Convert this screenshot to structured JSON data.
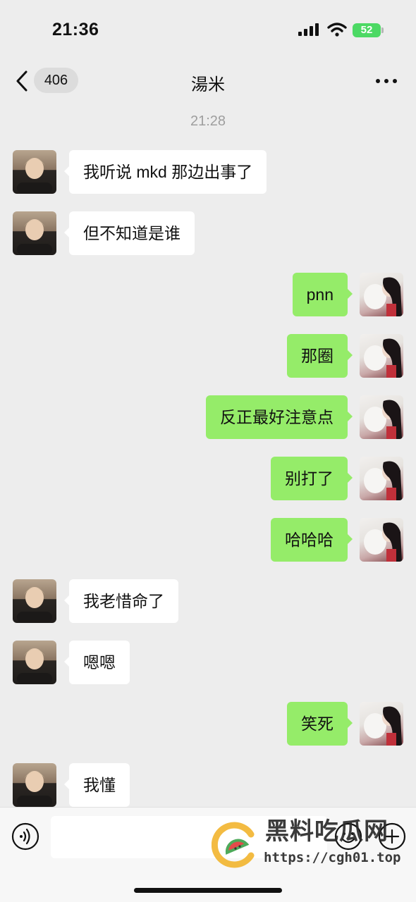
{
  "status_bar": {
    "time": "21:36",
    "battery": "52"
  },
  "nav": {
    "unread_count": "406",
    "title": "湯米"
  },
  "chat": {
    "timestamp": "21:28",
    "messages": [
      {
        "from": "friend",
        "text": "我听说 mkd 那边出事了"
      },
      {
        "from": "friend",
        "text": "但不知道是谁"
      },
      {
        "from": "me",
        "text": "pnn"
      },
      {
        "from": "me",
        "text": "那圈"
      },
      {
        "from": "me",
        "text": "反正最好注意点"
      },
      {
        "from": "me",
        "text": "别打了"
      },
      {
        "from": "me",
        "text": "哈哈哈"
      },
      {
        "from": "friend",
        "text": "我老惜命了"
      },
      {
        "from": "friend",
        "text": "嗯嗯"
      },
      {
        "from": "me",
        "text": "笑死"
      },
      {
        "from": "friend",
        "text": "我懂"
      }
    ]
  },
  "input_bar": {
    "text": ""
  },
  "watermark": {
    "title": "黑料吃瓜网",
    "url": "https://cgh01.top"
  },
  "colors": {
    "background": "#ededed",
    "bubble_out": "#95ec69",
    "bubble_in": "#ffffff",
    "battery": "#4cd964"
  },
  "icons": [
    "signal-icon",
    "wifi-icon",
    "back-chevron-icon",
    "more-icon",
    "voice-icon",
    "emoji-icon",
    "plus-icon"
  ]
}
